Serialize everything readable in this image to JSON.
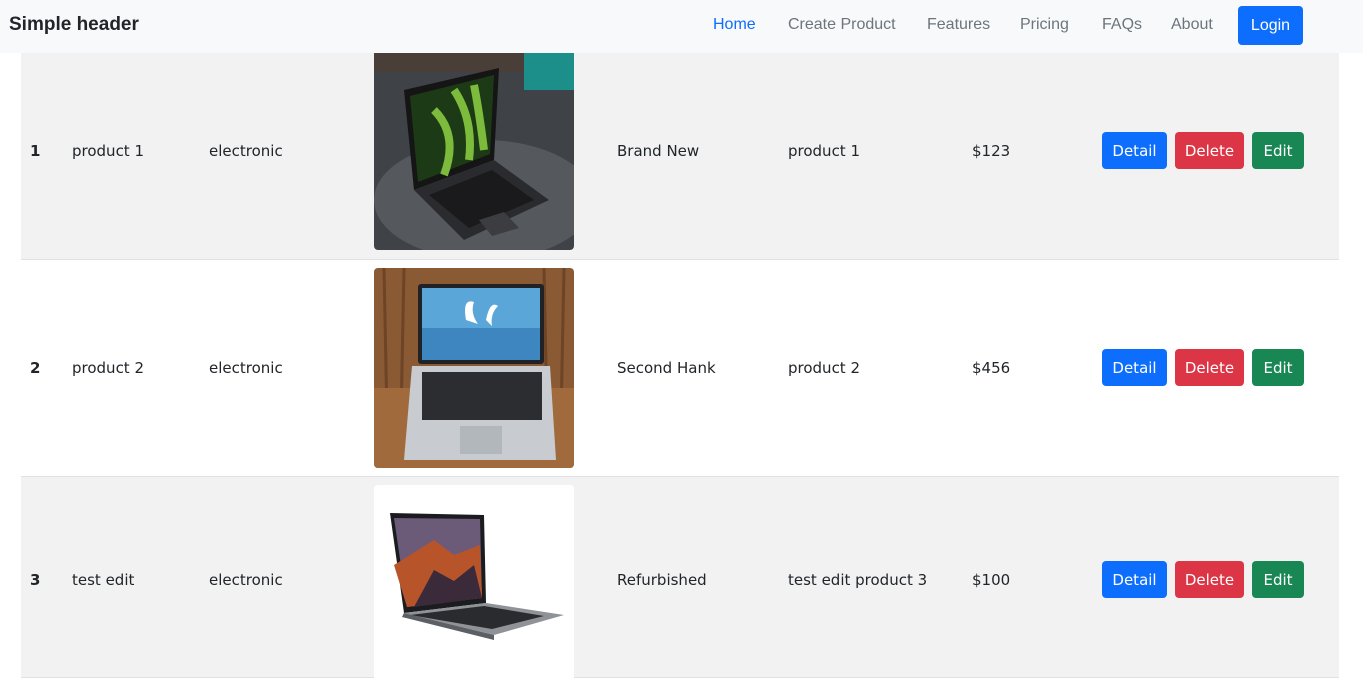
{
  "header": {
    "brand": "Simple header",
    "nav": [
      {
        "label": "Home",
        "active": true
      },
      {
        "label": "Create Product",
        "active": false
      },
      {
        "label": "Features",
        "active": false
      },
      {
        "label": "Pricing",
        "active": false
      },
      {
        "label": "FAQs",
        "active": false
      },
      {
        "label": "About",
        "active": false
      }
    ],
    "login_label": "Login"
  },
  "colors": {
    "primary": "#0d6efd",
    "danger": "#dc3545",
    "success": "#198754",
    "stripe": "#f2f2f2",
    "header_bg": "#f8f9fa"
  },
  "products": [
    {
      "id": "1",
      "name": "product 1",
      "category": "electronic",
      "image_icon": "laptop-photo-1",
      "condition": "Brand New",
      "description": "product 1",
      "price": "$123",
      "detail_label": "Detail",
      "delete_label": "Delete",
      "edit_label": "Edit"
    },
    {
      "id": "2",
      "name": "product 2",
      "category": "electronic",
      "image_icon": "laptop-photo-2",
      "condition": "Second Hank",
      "description": "product 2",
      "price": "$456",
      "detail_label": "Detail",
      "delete_label": "Delete",
      "edit_label": "Edit"
    },
    {
      "id": "3",
      "name": "test edit",
      "category": "electronic",
      "image_icon": "laptop-photo-3",
      "condition": "Refurbished",
      "description": "test edit product 3",
      "price": "$100",
      "detail_label": "Detail",
      "delete_label": "Delete",
      "edit_label": "Edit"
    }
  ]
}
